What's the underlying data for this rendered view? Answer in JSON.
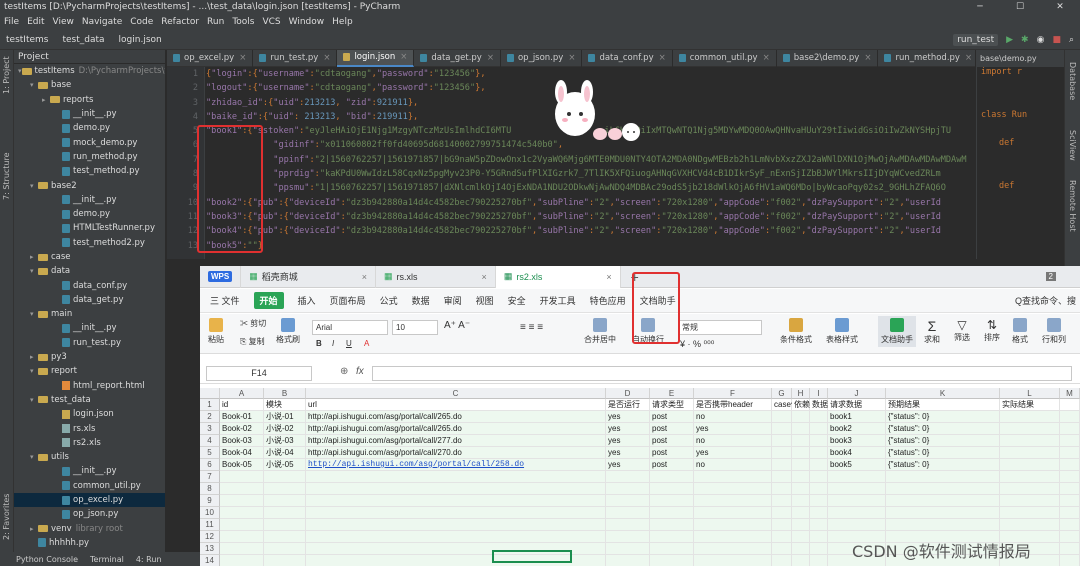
{
  "titlebar": {
    "title": "testItems [D:\\PycharmProjects\\testItems] - ...\\test_data\\login.json [testItems] - PyCharm"
  },
  "menu": [
    "File",
    "Edit",
    "View",
    "Navigate",
    "Code",
    "Refactor",
    "Run",
    "Tools",
    "VCS",
    "Window",
    "Help"
  ],
  "breadcrumbs": [
    "testItems",
    "test_data",
    "login.json"
  ],
  "run_config": "run_test",
  "project": {
    "header": "Project",
    "items": [
      {
        "label": "testItems",
        "extra": "D:\\PycharmProjects\\t",
        "type": "folder",
        "lvl": 0,
        "open": true
      },
      {
        "label": "base",
        "type": "folder",
        "lvl": 1,
        "open": true
      },
      {
        "label": "reports",
        "type": "folder",
        "lvl": 2
      },
      {
        "label": "__init__.py",
        "type": "py",
        "lvl": 3
      },
      {
        "label": "demo.py",
        "type": "py",
        "lvl": 3
      },
      {
        "label": "mock_demo.py",
        "type": "py",
        "lvl": 3
      },
      {
        "label": "run_method.py",
        "type": "py",
        "lvl": 3
      },
      {
        "label": "test_method.py",
        "type": "py",
        "lvl": 3
      },
      {
        "label": "base2",
        "type": "folder",
        "lvl": 1,
        "open": true
      },
      {
        "label": "__init__.py",
        "type": "py",
        "lvl": 3
      },
      {
        "label": "demo.py",
        "type": "py",
        "lvl": 3
      },
      {
        "label": "HTMLTestRunner.py",
        "type": "py",
        "lvl": 3
      },
      {
        "label": "test_method2.py",
        "type": "py",
        "lvl": 3
      },
      {
        "label": "case",
        "type": "folder",
        "lvl": 1
      },
      {
        "label": "data",
        "type": "folder",
        "lvl": 1,
        "open": true
      },
      {
        "label": "data_conf.py",
        "type": "py",
        "lvl": 3
      },
      {
        "label": "data_get.py",
        "type": "py",
        "lvl": 3
      },
      {
        "label": "main",
        "type": "folder",
        "lvl": 1,
        "open": true
      },
      {
        "label": "__init__.py",
        "type": "py",
        "lvl": 3
      },
      {
        "label": "run_test.py",
        "type": "py",
        "lvl": 3
      },
      {
        "label": "py3",
        "type": "folder",
        "lvl": 1
      },
      {
        "label": "report",
        "type": "folder",
        "lvl": 1,
        "open": true
      },
      {
        "label": "html_report.html",
        "type": "html",
        "lvl": 3
      },
      {
        "label": "test_data",
        "type": "folder",
        "lvl": 1,
        "open": true
      },
      {
        "label": "login.json",
        "type": "json",
        "lvl": 3
      },
      {
        "label": "rs.xls",
        "type": "xls",
        "lvl": 3
      },
      {
        "label": "rs2.xls",
        "type": "xls",
        "lvl": 3
      },
      {
        "label": "utils",
        "type": "folder",
        "lvl": 1,
        "open": true
      },
      {
        "label": "__init__.py",
        "type": "py",
        "lvl": 3
      },
      {
        "label": "common_util.py",
        "type": "py",
        "lvl": 3
      },
      {
        "label": "op_excel.py",
        "type": "py",
        "lvl": 3,
        "hl": true
      },
      {
        "label": "op_json.py",
        "type": "py",
        "lvl": 3
      },
      {
        "label": "venv",
        "extra": "library root",
        "type": "folder",
        "lvl": 1
      },
      {
        "label": "hhhhh.py",
        "type": "py",
        "lvl": 1
      }
    ]
  },
  "left_stripe": [
    "1: Project",
    "7: Structure",
    "2: Favorites"
  ],
  "right_stripe": [
    "Database",
    "SciView",
    "Remote Host"
  ],
  "editor_tabs": [
    {
      "label": "op_excel.py",
      "t": "py"
    },
    {
      "label": "run_test.py",
      "t": "py"
    },
    {
      "label": "login.json",
      "t": "json",
      "active": true
    },
    {
      "label": "data_get.py",
      "t": "py"
    },
    {
      "label": "op_json.py",
      "t": "py"
    },
    {
      "label": "data_conf.py",
      "t": "py"
    },
    {
      "label": "common_util.py",
      "t": "py"
    },
    {
      "label": "base2\\demo.py",
      "t": "py"
    },
    {
      "label": "run_method.py",
      "t": "py"
    }
  ],
  "right_tab": "base\\demo.py",
  "right_code": [
    "import r",
    "",
    "",
    "class Run",
    "",
    "def",
    "",
    "",
    "def",
    "",
    ""
  ],
  "gutter": [
    "1",
    "2",
    "3",
    "4",
    "5",
    "6",
    "7",
    "8",
    "9",
    "10",
    "11",
    "12",
    "13"
  ],
  "code": [
    [
      [
        "p",
        "{"
      ],
      [
        "k",
        "\"login\""
      ],
      [
        "p",
        ":{"
      ],
      [
        "k",
        "\"username\""
      ],
      [
        "p",
        ":"
      ],
      [
        "s",
        "\"cdtaogang\""
      ],
      [
        "p",
        ","
      ],
      [
        "k",
        "\"password\""
      ],
      [
        "p",
        ":"
      ],
      [
        "s",
        "\"123456\""
      ],
      [
        "p",
        "},"
      ]
    ],
    [
      [
        "k",
        "\"logout\""
      ],
      [
        "p",
        ":{"
      ],
      [
        "k",
        "\"username\""
      ],
      [
        "p",
        ":"
      ],
      [
        "s",
        "\"cdtaogang\""
      ],
      [
        "p",
        ","
      ],
      [
        "k",
        "\"password\""
      ],
      [
        "p",
        ":"
      ],
      [
        "s",
        "\"123456\""
      ],
      [
        "p",
        "},"
      ]
    ],
    [
      [
        "k",
        "\"zhidao_id\""
      ],
      [
        "p",
        ":{"
      ],
      [
        "k",
        "\"uid\""
      ],
      [
        "p",
        ":"
      ],
      [
        "n",
        "213213"
      ],
      [
        "p",
        ", "
      ],
      [
        "k",
        "\"zid\""
      ],
      [
        "p",
        ":"
      ],
      [
        "n",
        "921911"
      ],
      [
        "p",
        "},"
      ]
    ],
    [
      [
        "k",
        "\"baike_id\""
      ],
      [
        "p",
        ":{"
      ],
      [
        "k",
        "\"uid\""
      ],
      [
        "p",
        ": "
      ],
      [
        "n",
        "213213"
      ],
      [
        "p",
        ", "
      ],
      [
        "k",
        "\"bid\""
      ],
      [
        "p",
        ":"
      ],
      [
        "n",
        "219911"
      ],
      [
        "p",
        "},"
      ]
    ],
    [
      [
        "k",
        "\"book1\""
      ],
      [
        "p",
        ":{"
      ],
      [
        "k",
        "\"sstoken\""
      ],
      [
        "p",
        ":"
      ],
      [
        "s",
        "\"eyJleHAiOjE1Njg1MzgyNTczMzUsImlhdCI6MTU                  iLCHAiOiIxMTQwNTQ1Njg5MDYwMDQ0OAwQHNvaHUuY29tIiwidGsiOiIwZkNYSHpjTU"
      ]
    ],
    [
      [
        "p",
        "             "
      ],
      [
        "k",
        "\"gidinf\""
      ],
      [
        "p",
        ":"
      ],
      [
        "s",
        "\"x011060802ff0fd40695d68140002799751474c540b0\""
      ],
      [
        "p",
        ","
      ]
    ],
    [
      [
        "p",
        "             "
      ],
      [
        "k",
        "\"ppinf\""
      ],
      [
        "p",
        ":"
      ],
      [
        "s",
        "\"2|1560762257|1561971857|bG9naW5pZDowOnx1c2VyaWQ6Mjg6MTE0MDU0NTY4OTA2MDA0NDgwMEBzb2h1LmNvbXxzZXJ2aWNlDXN1OjMwOjAwMDAwMDAwMDAwM"
      ]
    ],
    [
      [
        "p",
        "             "
      ],
      [
        "k",
        "\"pprdig\""
      ],
      [
        "p",
        ":"
      ],
      [
        "s",
        "\"kaKPdU0WwIdzL58CqxNz5pgMyv23P0-Y5GRndSufPlXIGzrk7_7TlIK5XFQiuogAHNqGVXHCVd4cB1DIkrSyF_nExnSjIZbBJWYlMkrsIIjDYqWCvedZRLm"
      ]
    ],
    [
      [
        "p",
        "             "
      ],
      [
        "k",
        "\"ppsmu\""
      ],
      [
        "p",
        ":"
      ],
      [
        "s",
        "\"1|1560762257|1561971857|dXNlcmlkOjI4OjExNDA1NDU2ODkwNjAwNDQ4MDBAc29odS5jb218dWlkOjA6fHV1aWQ6MDo|byWcaoPqy02s2_9GHLhZFAQ6O"
      ]
    ],
    [
      [
        "k",
        "\"book2\""
      ],
      [
        "p",
        ":{"
      ],
      [
        "k",
        "\"pub\""
      ],
      [
        "p",
        ":{"
      ],
      [
        "k",
        "\"deviceId\""
      ],
      [
        "p",
        ":"
      ],
      [
        "s",
        "\"dz3b942880a14d4c4582bec790225270bf\""
      ],
      [
        "p",
        ","
      ],
      [
        "k",
        "\"subPline\""
      ],
      [
        "p",
        ":"
      ],
      [
        "s",
        "\"2\""
      ],
      [
        "p",
        ","
      ],
      [
        "k",
        "\"screen\""
      ],
      [
        "p",
        ":"
      ],
      [
        "s",
        "\"720x1280\""
      ],
      [
        "p",
        ","
      ],
      [
        "k",
        "\"appCode\""
      ],
      [
        "p",
        ":"
      ],
      [
        "s",
        "\"f002\""
      ],
      [
        "p",
        ","
      ],
      [
        "k",
        "\"dzPaySupport\""
      ],
      [
        "p",
        ":"
      ],
      [
        "s",
        "\"2\""
      ],
      [
        "p",
        ","
      ],
      [
        "k",
        "\"userId"
      ]
    ],
    [
      [
        "k",
        "\"book3\""
      ],
      [
        "p",
        ":{"
      ],
      [
        "k",
        "\"pub\""
      ],
      [
        "p",
        ":{"
      ],
      [
        "k",
        "\"deviceId\""
      ],
      [
        "p",
        ":"
      ],
      [
        "s",
        "\"dz3b942880a14d4c4582bec790225270bf\""
      ],
      [
        "p",
        ","
      ],
      [
        "k",
        "\"subPline\""
      ],
      [
        "p",
        ":"
      ],
      [
        "s",
        "\"2\""
      ],
      [
        "p",
        ","
      ],
      [
        "k",
        "\"screen\""
      ],
      [
        "p",
        ":"
      ],
      [
        "s",
        "\"720x1280\""
      ],
      [
        "p",
        ","
      ],
      [
        "k",
        "\"appCode\""
      ],
      [
        "p",
        ":"
      ],
      [
        "s",
        "\"f002\""
      ],
      [
        "p",
        ","
      ],
      [
        "k",
        "\"dzPaySupport\""
      ],
      [
        "p",
        ":"
      ],
      [
        "s",
        "\"2\""
      ],
      [
        "p",
        ","
      ],
      [
        "k",
        "\"userId"
      ]
    ],
    [
      [
        "k",
        "\"book4\""
      ],
      [
        "p",
        ":{"
      ],
      [
        "k",
        "\"pub\""
      ],
      [
        "p",
        ":{"
      ],
      [
        "k",
        "\"deviceId\""
      ],
      [
        "p",
        ":"
      ],
      [
        "s",
        "\"dz3b942880a14d4c4582bec790225270bf\""
      ],
      [
        "p",
        ","
      ],
      [
        "k",
        "\"subPline\""
      ],
      [
        "p",
        ":"
      ],
      [
        "s",
        "\"2\""
      ],
      [
        "p",
        ","
      ],
      [
        "k",
        "\"screen\""
      ],
      [
        "p",
        ":"
      ],
      [
        "s",
        "\"720x1280\""
      ],
      [
        "p",
        ","
      ],
      [
        "k",
        "\"appCode\""
      ],
      [
        "p",
        ":"
      ],
      [
        "s",
        "\"f002\""
      ],
      [
        "p",
        ","
      ],
      [
        "k",
        "\"dzPaySupport\""
      ],
      [
        "p",
        ":"
      ],
      [
        "s",
        "\"2\""
      ],
      [
        "p",
        ","
      ],
      [
        "k",
        "\"userId"
      ]
    ],
    [
      [
        "k",
        "\"book5\""
      ],
      [
        "p",
        ":"
      ],
      [
        "s",
        "\"\""
      ],
      [
        "p",
        "}"
      ]
    ]
  ],
  "wps": {
    "tabs": [
      {
        "label": "WPS",
        "logo": true
      },
      {
        "label": "稻壳商城"
      },
      {
        "label": "rs.xls"
      },
      {
        "label": "rs2.xls",
        "active": true
      }
    ],
    "page_num": "2",
    "menu": [
      "三 文件",
      "开始",
      "插入",
      "页面布局",
      "公式",
      "数据",
      "审阅",
      "视图",
      "安全",
      "开发工具",
      "特色应用",
      "文档助手"
    ],
    "search": "Q查找命令、搜",
    "ribbon": {
      "paste": "粘贴",
      "cut": "剪切",
      "copy": "复制",
      "fmt": "格式刷",
      "font": "Arial",
      "size": "10",
      "merge": "合并居中",
      "wrap": "自动换行",
      "numfmt": "常规",
      "cond": "条件格式",
      "tblstyle": "表格样式",
      "doc": "文档助手",
      "sum": "求和",
      "filter": "筛选",
      "sort": "排序",
      "format": "格式",
      "rowcol": "行和列"
    },
    "namebox": "F14",
    "fx": "fx",
    "cols": [
      "A",
      "B",
      "C",
      "D",
      "E",
      "F",
      "G",
      "H",
      "I",
      "J",
      "K",
      "L",
      "M"
    ],
    "rows": [
      "1",
      "2",
      "3",
      "4",
      "5",
      "6",
      "7",
      "8",
      "9",
      "10",
      "11",
      "12",
      "13",
      "14"
    ],
    "header_row": [
      "id",
      "模块",
      "url",
      "是否运行",
      "请求类型",
      "是否携带header",
      "case依赖",
      "依赖的返回",
      "数据依赖",
      "请求数据",
      "预期结果",
      "实际结果"
    ],
    "data": [
      [
        "Book-01",
        "小说-01",
        "http://api.ishugui.com/asg/portal/call/265.do",
        "yes",
        "post",
        "no",
        "",
        "",
        "",
        "book1",
        "{\"status\": 0}",
        ""
      ],
      [
        "Book-02",
        "小说-02",
        "http://api.ishugui.com/asg/portal/call/265.do",
        "yes",
        "post",
        "yes",
        "",
        "",
        "",
        "book2",
        "{\"status\": 0}",
        ""
      ],
      [
        "Book-03",
        "小说-03",
        "http://api.ishugui.com/asg/portal/call/277.do",
        "yes",
        "post",
        "no",
        "",
        "",
        "",
        "book3",
        "{\"status\": 0}",
        ""
      ],
      [
        "Book-04",
        "小说-04",
        "http://api.ishugui.com/asg/portal/call/270.do",
        "yes",
        "post",
        "yes",
        "",
        "",
        "",
        "book4",
        "{\"status\": 0}",
        ""
      ],
      [
        "Book-05",
        "小说-05",
        "http://api.ishugui.com/asg/portal/call/258.do",
        "yes",
        "post",
        "no",
        "",
        "",
        "",
        "book5",
        "{\"status\": 0}",
        ""
      ]
    ]
  },
  "bottom": [
    "Python Console",
    "Terminal",
    "4: Run"
  ],
  "watermark": "CSDN @软件测试情报局",
  "colors": {
    "accent_green": "#1b8e4f",
    "annot_red": "#e03030",
    "ide_bg": "#2b2b2b"
  }
}
